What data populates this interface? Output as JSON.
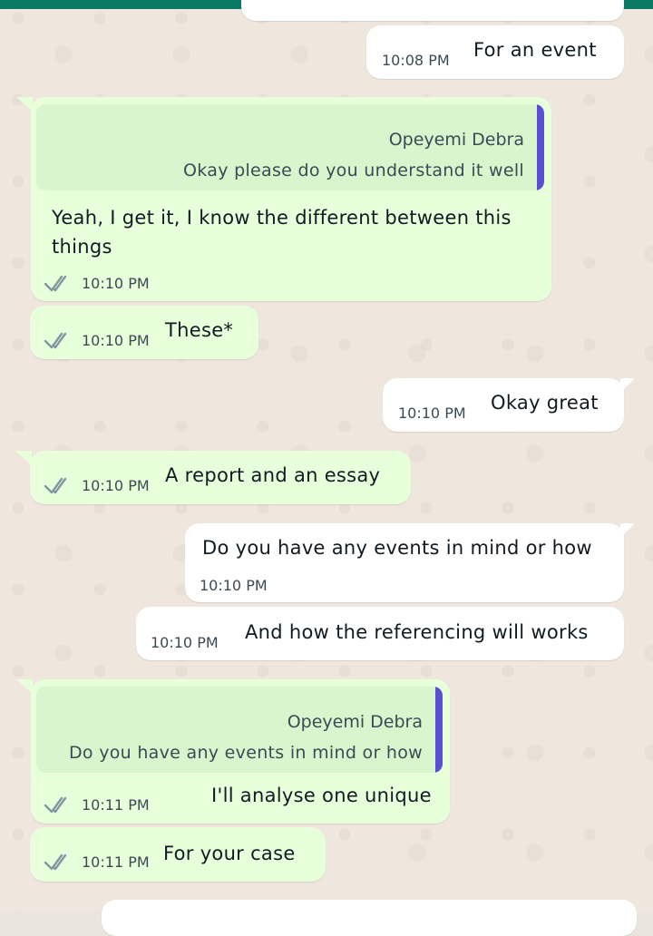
{
  "messages": [
    {
      "id": "m1",
      "text": "For an event",
      "time": "10:08 PM",
      "direction": "incoming"
    },
    {
      "id": "m2",
      "text": "Yeah, I get it, I know the different between this things",
      "time": "10:10 PM",
      "direction": "outgoing",
      "status": "read",
      "quote": {
        "author": "Opeyemi Debra",
        "text": "Okay please do you understand it well"
      }
    },
    {
      "id": "m3",
      "text": "These*",
      "time": "10:10 PM",
      "direction": "outgoing",
      "status": "read"
    },
    {
      "id": "m4",
      "text": "Okay great",
      "time": "10:10 PM",
      "direction": "incoming"
    },
    {
      "id": "m5",
      "text": "A report and an essay",
      "time": "10:10 PM",
      "direction": "outgoing",
      "status": "read"
    },
    {
      "id": "m6",
      "text": "Do you have any events in mind or how",
      "time": "10:10 PM",
      "direction": "incoming"
    },
    {
      "id": "m7",
      "text": "And how the referencing will works",
      "time": "10:10 PM",
      "direction": "incoming"
    },
    {
      "id": "m8",
      "text": "I'll analyse one unique",
      "time": "10:11 PM",
      "direction": "outgoing",
      "status": "read",
      "quote": {
        "author": "Opeyemi Debra",
        "text": "Do you have any events in mind or how"
      }
    },
    {
      "id": "m9",
      "text": "For your case",
      "time": "10:11 PM",
      "direction": "outgoing",
      "status": "read"
    }
  ],
  "colors": {
    "incoming_bubble": "#ffffff",
    "outgoing_bubble": "#e7ffdb",
    "quote_bar": "#5a4fcf",
    "header": "#0b7a64"
  },
  "icons": {
    "read_receipt": "double-check-icon"
  }
}
